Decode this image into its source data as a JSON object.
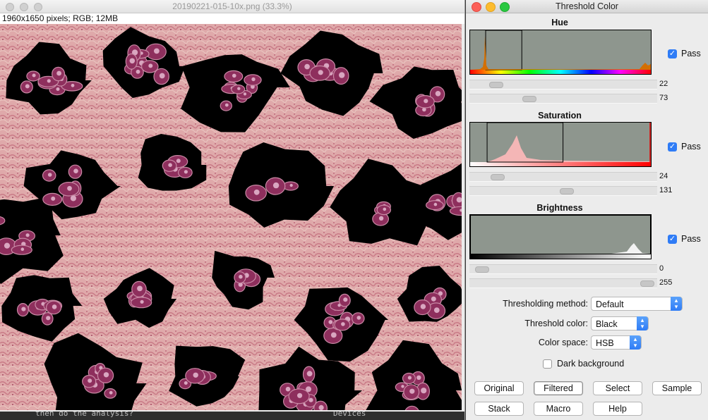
{
  "image_window": {
    "title": "20190221-015-10x.png (33.3%)",
    "info": "1960x1650 pixels; RGB; 12MB",
    "bottom_left_text": "then do the analysis?",
    "bottom_right_text": "Devices"
  },
  "panel": {
    "title": "Threshold Color",
    "hue": {
      "label": "Hue",
      "pass_label": "Pass",
      "pass_checked": true,
      "min": "22",
      "max": "73",
      "min_fraction": 0.086,
      "max_fraction": 0.286
    },
    "saturation": {
      "label": "Saturation",
      "pass_label": "Pass",
      "pass_checked": true,
      "min": "24",
      "max": "131",
      "min_fraction": 0.094,
      "max_fraction": 0.514
    },
    "brightness": {
      "label": "Brightness",
      "pass_label": "Pass",
      "pass_checked": true,
      "min": "0",
      "max": "255",
      "min_fraction": 0.0,
      "max_fraction": 1.0
    },
    "thresholding_method": {
      "label": "Thresholding method:",
      "value": "Default"
    },
    "threshold_color": {
      "label": "Threshold color:",
      "value": "Black"
    },
    "color_space": {
      "label": "Color space:",
      "value": "HSB"
    },
    "dark_background": {
      "label": "Dark background",
      "checked": false
    },
    "buttons": [
      "Original",
      "Filtered",
      "Select",
      "Sample",
      "Stack",
      "Macro",
      "Help"
    ]
  }
}
